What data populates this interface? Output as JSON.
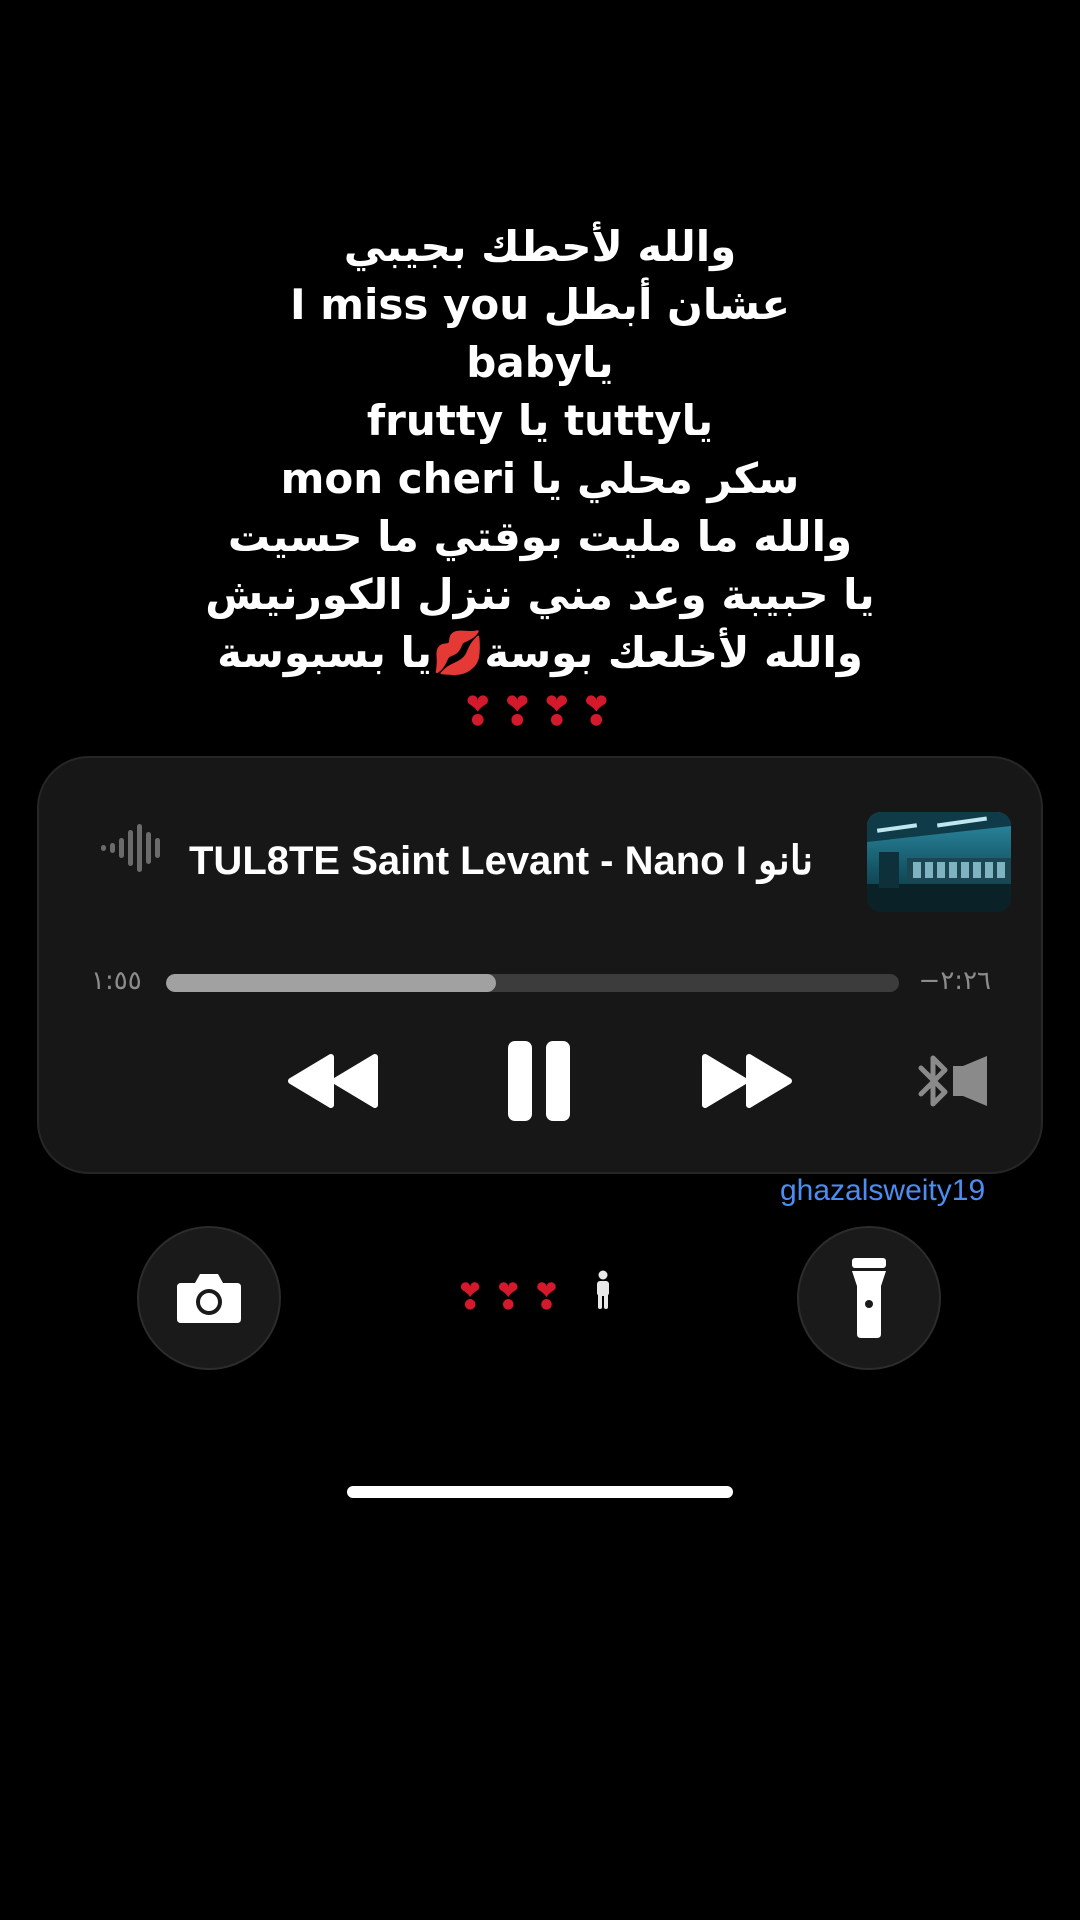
{
  "lyrics": [
    "والله لأحطك بجيبي",
    "عشان أبطل I miss you",
    "ياbaby",
    "ياtutty يا frutty",
    "سكر محلي يا mon cheri",
    "والله ما مليت بوقتي ما حسيت",
    "يا حبيبة وعد مني ننزل الكورنيش",
    "والله لأخلعك بوسة💋يا بسبوسة"
  ],
  "hearts_line": "❣❣❣❣",
  "player": {
    "title": "TUL8TE Saint Levant - Nano I نانو",
    "time_elapsed": "١:٥٥",
    "time_remaining": "−٢:٢٦",
    "progress": 0.45,
    "icons": {
      "wave": "waveform-icon",
      "rewind": "rewind-icon",
      "pause": "pause-icon",
      "forward": "fast-forward-icon",
      "airplay": "bluetooth-speaker-icon"
    }
  },
  "username": "ghazalsweity19",
  "bottom_emoji": "❣❣❣",
  "quick_actions": {
    "left": "camera-icon",
    "right": "flashlight-icon"
  },
  "colors": {
    "heart": "#d3192b",
    "username": "#4b8ef0",
    "card_bg": "#171717"
  }
}
